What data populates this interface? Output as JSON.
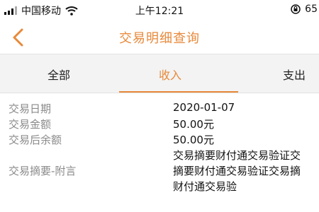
{
  "status_bar": {
    "carrier": "中国移动",
    "time": "上午12:21",
    "battery": "65"
  },
  "nav": {
    "title": "交易明细查询"
  },
  "tabs": [
    {
      "label": "全部",
      "active": false
    },
    {
      "label": "收入",
      "active": true
    },
    {
      "label": "支出",
      "active": false
    }
  ],
  "details": {
    "date_label": "交易日期",
    "date_value": "2020-01-07",
    "amount_label": "交易金额",
    "amount_value": "50.00元",
    "balance_label": "交易后余额",
    "balance_value": "50.00元",
    "memo_label": "交易摘要-附言",
    "memo_lines": [
      "交易摘要财付通交易验证交",
      "摘要财付通交易验证交易摘",
      "财付通交易验"
    ]
  },
  "colors": {
    "accent": "#e8893a"
  }
}
